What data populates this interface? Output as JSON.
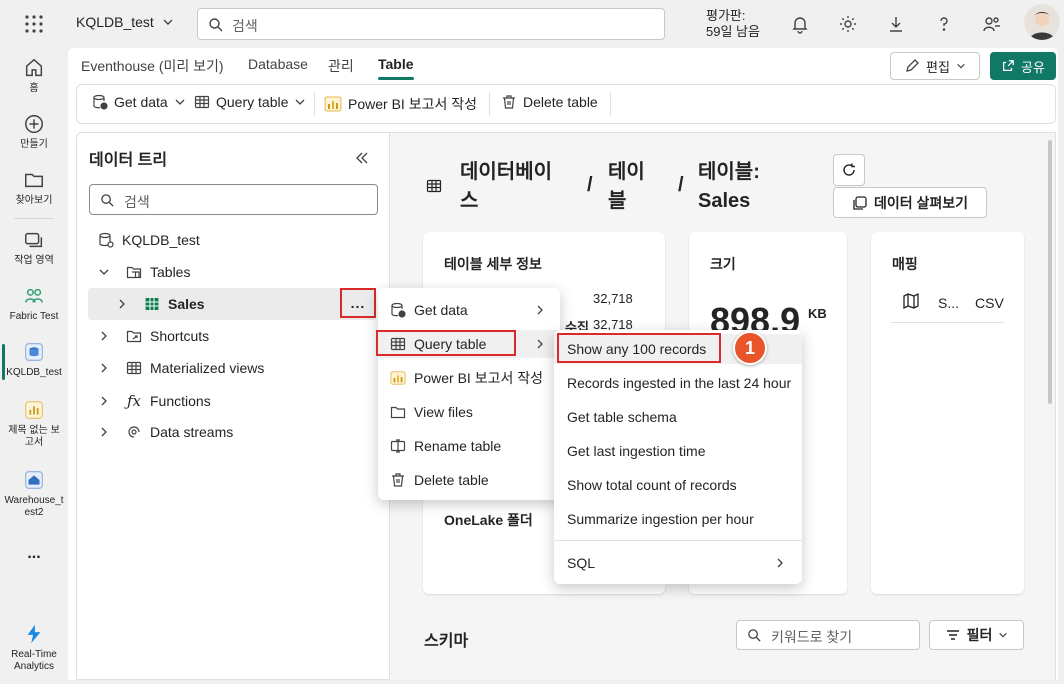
{
  "app": {
    "workspace_name": "KQLDB_test",
    "search_placeholder": "검색",
    "trial_line1": "평가판:",
    "trial_line2": "59일 남음"
  },
  "rail": {
    "items": [
      {
        "label": "홈",
        "icon": "home-icon"
      },
      {
        "label": "만들기",
        "icon": "create-icon"
      },
      {
        "label": "찾아보기",
        "icon": "browse-icon"
      },
      {
        "label": "작업 영역",
        "icon": "workspaces-icon"
      },
      {
        "label": "Fabric Test",
        "icon": "fabric-icon"
      },
      {
        "label": "KQLDB_test",
        "icon": "kql-db-icon"
      },
      {
        "label": "제목 없는 보고서",
        "icon": "report-icon"
      },
      {
        "label": "Warehouse_test2",
        "icon": "warehouse-icon"
      },
      {
        "label": "...",
        "icon": "more-icon"
      },
      {
        "label": "Real-Time Analytics",
        "icon": "rta-icon"
      }
    ]
  },
  "tabs": {
    "items": [
      "Eventhouse (미리 보기)",
      "Database",
      "관리",
      "Table"
    ],
    "active": "Table"
  },
  "header_buttons": {
    "edit": "편집",
    "share": "공유"
  },
  "toolbar": {
    "get_data": "Get data",
    "query_table": "Query table",
    "powerbi": "Power BI 보고서 작성",
    "delete_table": "Delete table"
  },
  "tree": {
    "title": "데이터 트리",
    "search_placeholder": "검색",
    "db_name": "KQLDB_test",
    "tables": "Tables",
    "sales": "Sales",
    "more": "...",
    "shortcuts": "Shortcuts",
    "materialized_views": "Materialized views",
    "functions": "Functions",
    "data_streams": "Data streams"
  },
  "breadcrumb": {
    "part1": "데이터베이스",
    "sep": "/",
    "part2": "테이블",
    "part3_prefix": "테이블:",
    "part3_name": "Sales",
    "explore_button": "데이터 살펴보기"
  },
  "cards": {
    "details_title": "테이블 세부 정보",
    "details_value1": "32,718",
    "details_label2_fragment": "수집",
    "details_value2": "32,718",
    "onelake": "OneLake 폴더",
    "size_title": "크기",
    "size_value": "898.9",
    "size_unit": "KB",
    "mapping_title": "매핑",
    "mapping_name": "S...",
    "mapping_type": "CSV"
  },
  "schema": {
    "title": "스키마",
    "search_placeholder": "키워드로 찾기",
    "filter": "필터"
  },
  "context_menu": {
    "items": [
      "Get data",
      "Query table",
      "Power BI 보고서 작성",
      "View files",
      "Rename table",
      "Delete table"
    ]
  },
  "submenu": {
    "items": [
      "Show any 100 records",
      "Records ingested in the last 24 hour",
      "Get table schema",
      "Get last ingestion time",
      "Show total count of records",
      "Summarize ingestion per hour",
      "SQL"
    ],
    "step_badge": "1"
  },
  "colors": {
    "accent": "#117865",
    "highlight": "#d92b2b",
    "badge": "#e8552a"
  }
}
